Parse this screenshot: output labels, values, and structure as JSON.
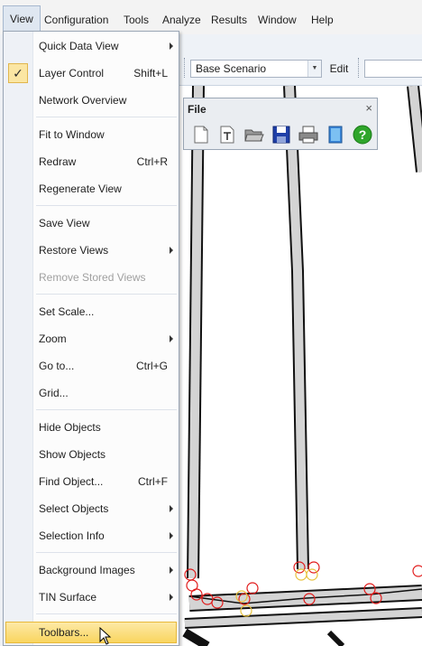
{
  "menubar": {
    "items": [
      "View",
      "Configuration",
      "Tools",
      "Analyze",
      "Results",
      "Window",
      "Help"
    ]
  },
  "toolbar": {
    "scenario_value": "Base Scenario",
    "edit_label": "Edit"
  },
  "file_toolbar": {
    "title": "File",
    "close_glyph": "×",
    "icons": [
      "new-document-icon",
      "new-text-icon",
      "open-folder-icon",
      "save-icon",
      "print-icon",
      "book-icon",
      "help-icon"
    ]
  },
  "view_menu": {
    "check_glyph": "✓",
    "items": [
      {
        "label": "Quick Data View",
        "shortcut": "",
        "submenu": true
      },
      {
        "label": "Layer Control",
        "shortcut": "Shift+L",
        "checked": true
      },
      {
        "label": "Network Overview",
        "shortcut": ""
      },
      {
        "label": "Fit to Window",
        "shortcut": ""
      },
      {
        "label": "Redraw",
        "shortcut": "Ctrl+R"
      },
      {
        "label": "Regenerate View",
        "shortcut": ""
      },
      {
        "label": "Save View",
        "shortcut": ""
      },
      {
        "label": "Restore Views",
        "shortcut": "",
        "submenu": true
      },
      {
        "label": "Remove Stored Views",
        "shortcut": "",
        "disabled": true
      },
      {
        "label": "Set Scale...",
        "shortcut": ""
      },
      {
        "label": "Zoom",
        "shortcut": "",
        "submenu": true
      },
      {
        "label": "Go to...",
        "shortcut": "Ctrl+G"
      },
      {
        "label": "Grid...",
        "shortcut": ""
      },
      {
        "label": "Hide Objects",
        "shortcut": ""
      },
      {
        "label": "Show Objects",
        "shortcut": ""
      },
      {
        "label": "Find Object...",
        "shortcut": "Ctrl+F"
      },
      {
        "label": "Select Objects",
        "shortcut": "",
        "submenu": true
      },
      {
        "label": "Selection Info",
        "shortcut": "",
        "submenu": true
      },
      {
        "label": "Background Images",
        "shortcut": "",
        "submenu": true
      },
      {
        "label": "TIN Surface",
        "shortcut": "",
        "submenu": true
      },
      {
        "label": "Toolbars...",
        "shortcut": "",
        "highlighted": true
      }
    ]
  },
  "colors": {
    "menu_highlight": "#f9d55f",
    "node_red": "#e11a1a",
    "node_yellow": "#e8c23c",
    "link_gray": "#d4d4d4"
  }
}
